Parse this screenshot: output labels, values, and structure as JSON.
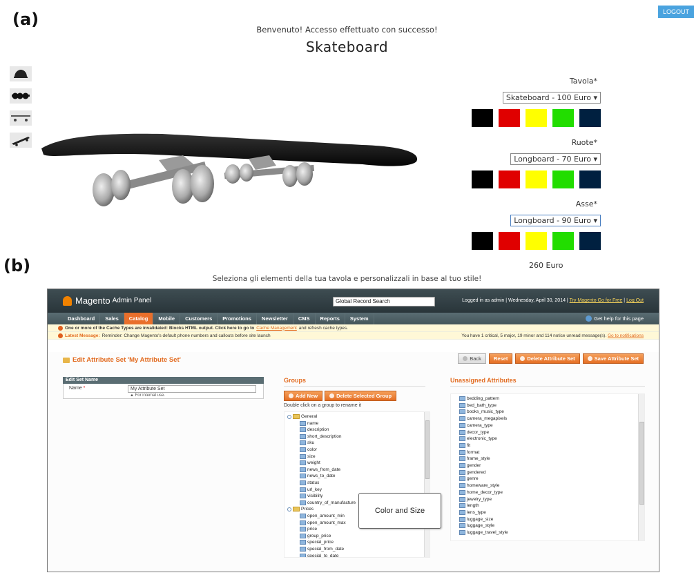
{
  "labels": {
    "a": "(a)",
    "b": "(b)"
  },
  "configurator": {
    "logout": "LOGOUT",
    "welcome": "Benvenuto! Accesso effettuato con successo!",
    "title": "Skateboard",
    "options": [
      {
        "label": "Tavola*",
        "selected": "Skateboard - 100 Euro ▾",
        "active": false
      },
      {
        "label": "Ruote*",
        "selected": "Longboard - 70 Euro ▾",
        "active": false
      },
      {
        "label": "Asse*",
        "selected": "Longboard - 90 Euro ▾",
        "active": true
      }
    ],
    "swatch_colors": [
      "#000000",
      "#e00000",
      "#ffff00",
      "#22dd00",
      "#002040"
    ],
    "thumb_icons": [
      "helmet-icon",
      "wheels-icon",
      "longboard-icon",
      "skateboard-icon"
    ],
    "total": "260 Euro",
    "tagline": "Seleziona gli elementi della tua tavola e personalizzali in base al tuo stile!"
  },
  "magento": {
    "logo": "Magento",
    "logo_sub": "Admin Panel",
    "search_value": "Global Record Search",
    "header_info": "Logged in as admin | Wednesday, April 30, 2014 |",
    "header_link_try": "Try Magento Go for Free",
    "header_link_logout": "Log Out",
    "nav": [
      "Dashboard",
      "Sales",
      "Catalog",
      "Mobile",
      "Customers",
      "Promotions",
      "Newsletter",
      "CMS",
      "Reports",
      "System"
    ],
    "nav_active": "Catalog",
    "help": "Get help for this page",
    "msg1_text": "One or more of the Cache Types are invalidated: Blocks HTML output. Click here to go to",
    "msg1_link": "Cache Management",
    "msg1_tail": "and refresh cache types.",
    "msg2_label": "Latest Message:",
    "msg2_text": "Reminder: Change Magento's default phone numbers and callouts before site launch",
    "msg2_right": "You have 1 critical, 5 major, 19 minor and 114 notice unread message(s).",
    "msg2_link": "Go to notifications",
    "page_title": "Edit Attribute Set 'My Attribute Set'",
    "buttons": {
      "back": "Back",
      "reset": "Reset",
      "delete": "Delete Attribute Set",
      "save": "Save Attribute Set"
    },
    "edit_set": {
      "header": "Edit Set Name",
      "name_label": "Name",
      "name_value": "My Attribute Set",
      "hint": "▲ For internal use."
    },
    "groups": {
      "title": "Groups",
      "add": "Add New",
      "delete": "Delete Selected Group",
      "dbl": "Double click on a group to rename it",
      "general": "General",
      "general_items": [
        "name",
        "description",
        "short_description",
        "sku",
        "color",
        "size",
        "weight",
        "news_from_date",
        "news_to_date",
        "status",
        "url_key",
        "visibility",
        "country_of_manufacture"
      ],
      "prices": "Prices",
      "prices_items": [
        "open_amount_min",
        "open_amount_max",
        "price",
        "group_price",
        "special_price",
        "special_from_date",
        "special_to_date"
      ]
    },
    "callout": "Color and Size",
    "unassigned": {
      "title": "Unassigned Attributes",
      "items": [
        "bedding_pattern",
        "bed_bath_type",
        "books_music_type",
        "camera_megapixels",
        "camera_type",
        "decor_type",
        "electronic_type",
        "fit",
        "format",
        "frame_style",
        "gender",
        "gendered",
        "genre",
        "homeware_style",
        "home_decor_type",
        "jewelry_type",
        "length",
        "lens_type",
        "luggage_size",
        "luggage_style",
        "luggage_travel_style"
      ]
    }
  }
}
